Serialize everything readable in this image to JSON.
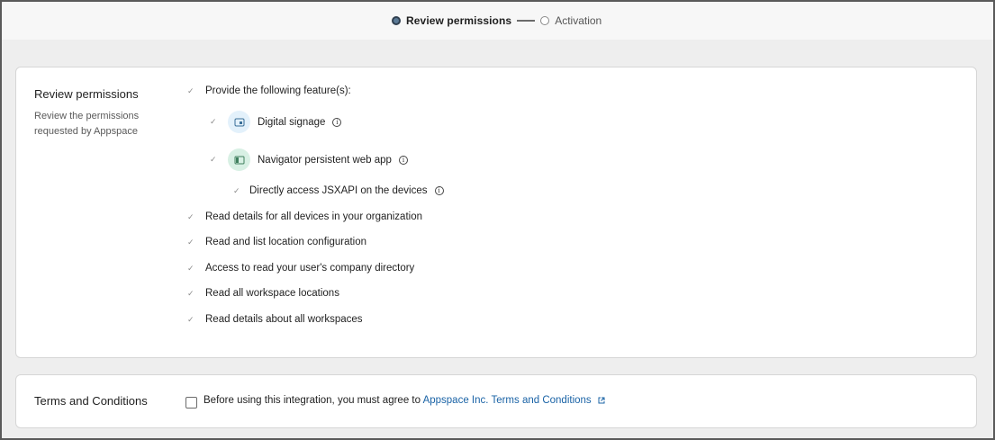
{
  "stepper": {
    "step1": "Review permissions",
    "step2": "Activation"
  },
  "permissions": {
    "title": "Review permissions",
    "subtitle": "Review the permissions requested by Appspace",
    "feature_intro": "Provide the following feature(s):",
    "features": [
      {
        "label": "Digital signage",
        "icon": "display-icon"
      },
      {
        "label": "Navigator persistent web app",
        "icon": "panel-icon"
      }
    ],
    "sub_feature": "Directly access JSXAPI on the devices",
    "items": [
      "Read details for all devices in your organization",
      "Read and list location configuration",
      "Access to read your user's company directory",
      "Read all workspace locations",
      "Read details about all workspaces"
    ]
  },
  "terms": {
    "title": "Terms and Conditions",
    "text": "Before using this integration, you must agree to",
    "link": "Appspace Inc. Terms and Conditions",
    "checked": false
  },
  "colors": {
    "link": "#1a63a6",
    "background": "#eeeeee",
    "card": "#ffffff"
  }
}
